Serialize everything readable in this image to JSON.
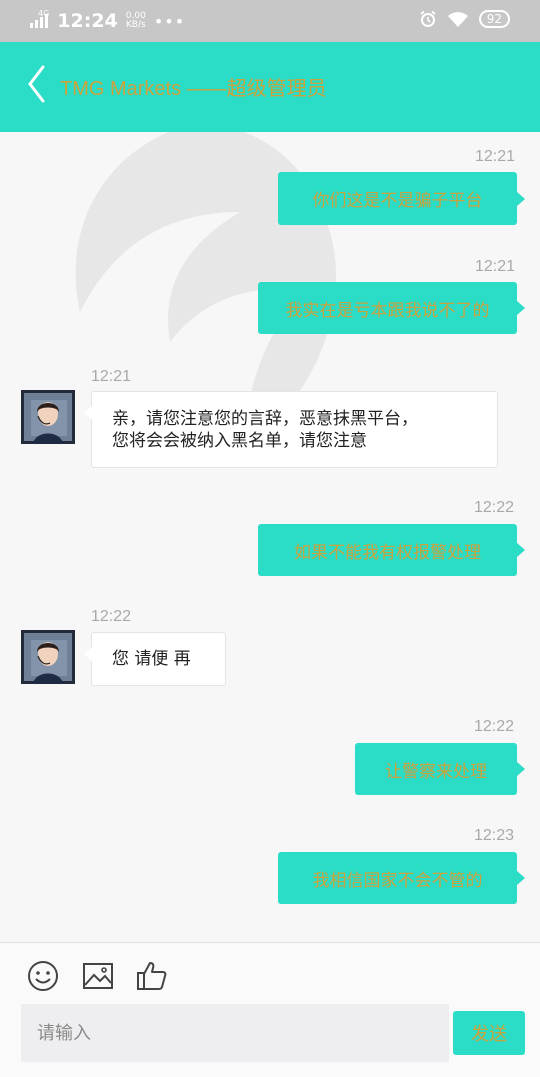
{
  "status_bar": {
    "network": "4G",
    "time": "12:24",
    "speed_value": "0.00",
    "speed_unit": "KB/s",
    "dots": "•••",
    "battery": "92"
  },
  "header": {
    "title": "TMG Markets ——超级管理员",
    "back_icon": "chevron-left-icon"
  },
  "messages": [
    {
      "direction": "out",
      "time": "12:21",
      "lines": [
        "你们这是不是骗子平台"
      ]
    },
    {
      "direction": "out",
      "time": "12:21",
      "lines": [
        "我实在是亏本跟我说不了的"
      ]
    },
    {
      "direction": "in",
      "time": "12:21",
      "lines": [
        "亲，请您注意您的言辞，恶意抹黑平台，",
        "您将会会被纳入黑名单，请您注意"
      ]
    },
    {
      "direction": "out",
      "time": "12:22",
      "lines": [
        "如果不能我有权报警处理"
      ]
    },
    {
      "direction": "in",
      "time": "12:22",
      "lines": [
        "您 请便 再"
      ]
    },
    {
      "direction": "out",
      "time": "12:22",
      "lines": [
        "让警察来处理"
      ]
    },
    {
      "direction": "out",
      "time": "12:23",
      "lines": [
        "我相信国家不会不管的"
      ]
    }
  ],
  "toolbar": {
    "icons": [
      "emoji-icon",
      "image-icon",
      "thumbs-up-icon"
    ],
    "input_placeholder": "请输入",
    "send_label": "发送"
  },
  "colors": {
    "accent": "#2bdcc6",
    "accent_text": "#c9a23c",
    "status_bar": "#c7c7c7"
  }
}
